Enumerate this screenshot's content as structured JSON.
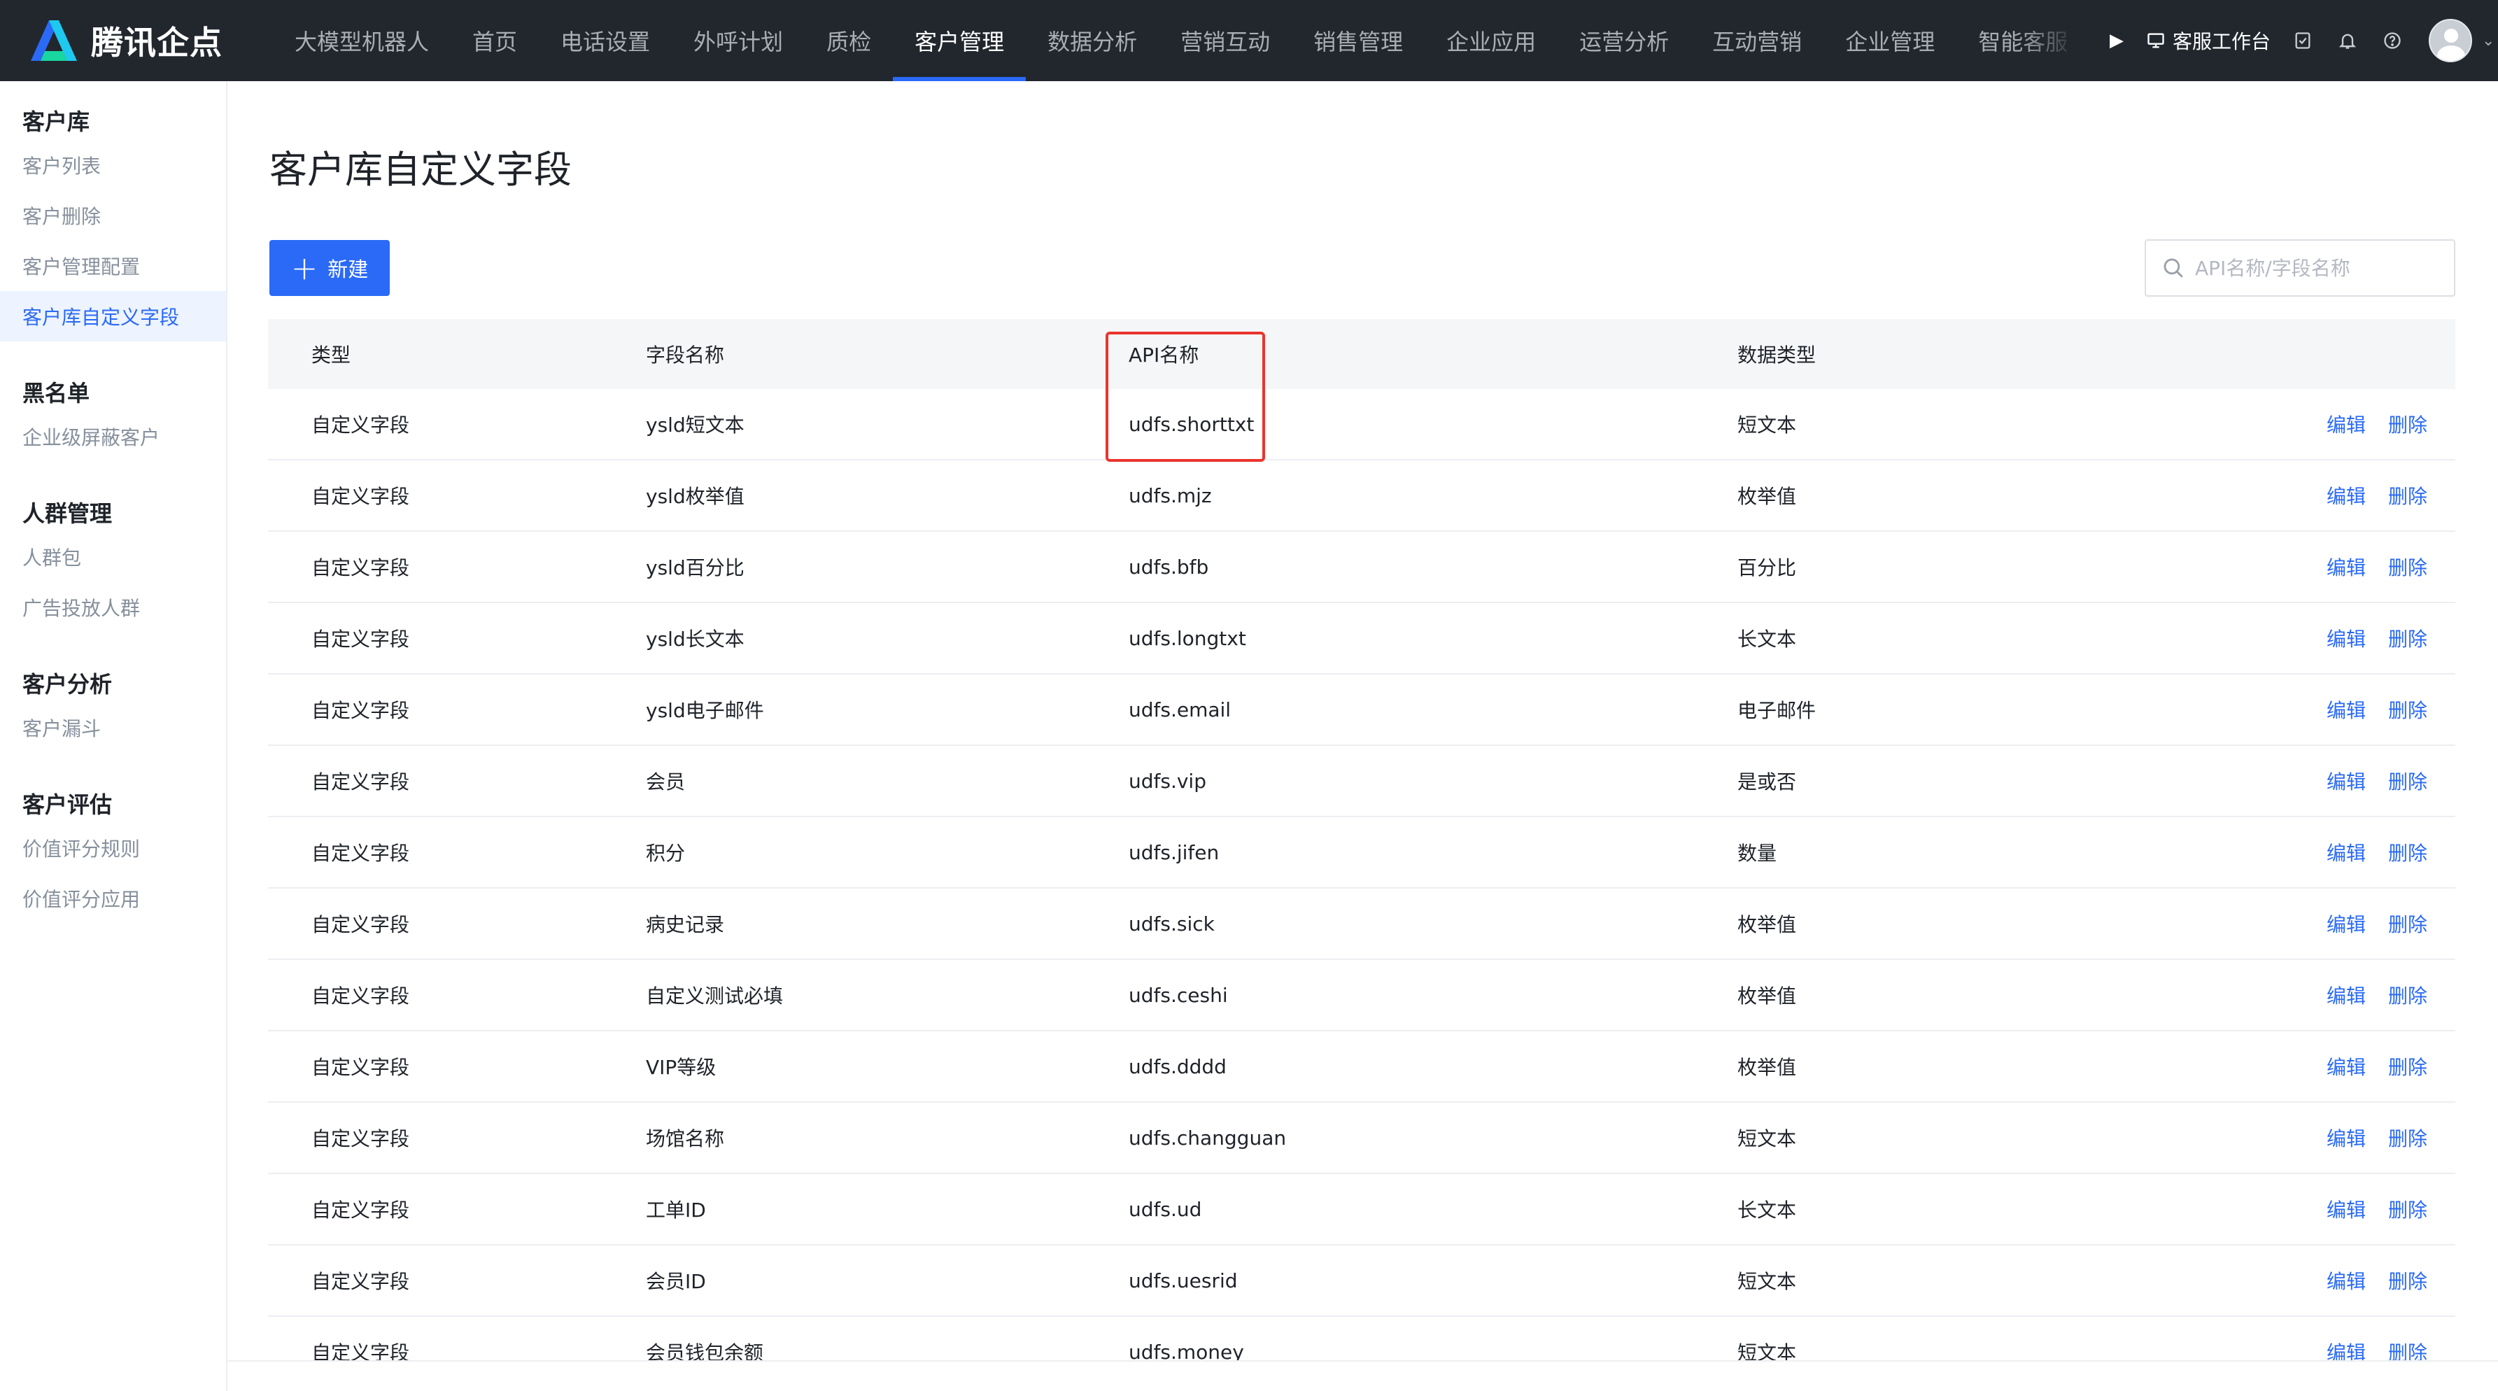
{
  "brand": {
    "name": "腾讯企点"
  },
  "nav": {
    "items": [
      "大模型机器人",
      "首页",
      "电话设置",
      "外呼计划",
      "质检",
      "客户管理",
      "数据分析",
      "营销互动",
      "销售管理",
      "企业应用",
      "运营分析",
      "互动营销",
      "企业管理",
      "智能客服"
    ],
    "active_index": 5,
    "workbench": "客服工作台"
  },
  "sidebar": {
    "groups": [
      {
        "title": "客户库",
        "items": [
          "客户列表",
          "客户删除",
          "客户管理配置",
          "客户库自定义字段"
        ]
      },
      {
        "title": "黑名单",
        "items": [
          "企业级屏蔽客户"
        ]
      },
      {
        "title": "人群管理",
        "items": [
          "人群包",
          "广告投放人群"
        ]
      },
      {
        "title": "客户分析",
        "items": [
          "客户漏斗"
        ]
      },
      {
        "title": "客户评估",
        "items": [
          "价值评分规则",
          "价值评分应用"
        ]
      }
    ],
    "active_item": "客户库自定义字段"
  },
  "main": {
    "title": "客户库自定义字段",
    "new_button": "新建",
    "search_placeholder": "API名称/字段名称"
  },
  "table": {
    "headers": {
      "type": "类型",
      "name": "字段名称",
      "api": "API名称",
      "dtype": "数据类型"
    },
    "actions": {
      "edit": "编辑",
      "delete": "删除"
    },
    "rows": [
      {
        "type": "自定义字段",
        "name": "ysld短文本",
        "api": "udfs.shorttxt",
        "dtype": "短文本"
      },
      {
        "type": "自定义字段",
        "name": "ysld枚举值",
        "api": "udfs.mjz",
        "dtype": "枚举值"
      },
      {
        "type": "自定义字段",
        "name": "ysld百分比",
        "api": "udfs.bfb",
        "dtype": "百分比"
      },
      {
        "type": "自定义字段",
        "name": "ysld长文本",
        "api": "udfs.longtxt",
        "dtype": "长文本"
      },
      {
        "type": "自定义字段",
        "name": "ysld电子邮件",
        "api": "udfs.email",
        "dtype": "电子邮件"
      },
      {
        "type": "自定义字段",
        "name": "会员",
        "api": "udfs.vip",
        "dtype": "是或否"
      },
      {
        "type": "自定义字段",
        "name": "积分",
        "api": "udfs.jifen",
        "dtype": "数量"
      },
      {
        "type": "自定义字段",
        "name": "病史记录",
        "api": "udfs.sick",
        "dtype": "枚举值"
      },
      {
        "type": "自定义字段",
        "name": "自定义测试必填",
        "api": "udfs.ceshi",
        "dtype": "枚举值"
      },
      {
        "type": "自定义字段",
        "name": "VIP等级",
        "api": "udfs.dddd",
        "dtype": "枚举值"
      },
      {
        "type": "自定义字段",
        "name": "场馆名称",
        "api": "udfs.changguan",
        "dtype": "短文本"
      },
      {
        "type": "自定义字段",
        "name": "工单ID",
        "api": "udfs.ud",
        "dtype": "长文本"
      },
      {
        "type": "自定义字段",
        "name": "会员ID",
        "api": "udfs.uesrid",
        "dtype": "短文本"
      },
      {
        "type": "自定义字段",
        "name": "会员钱包余额",
        "api": "udfs.money",
        "dtype": "短文本"
      }
    ]
  },
  "colors": {
    "accent": "#2a6af6",
    "topbar": "#22272e",
    "highlight": "#e9352d"
  }
}
